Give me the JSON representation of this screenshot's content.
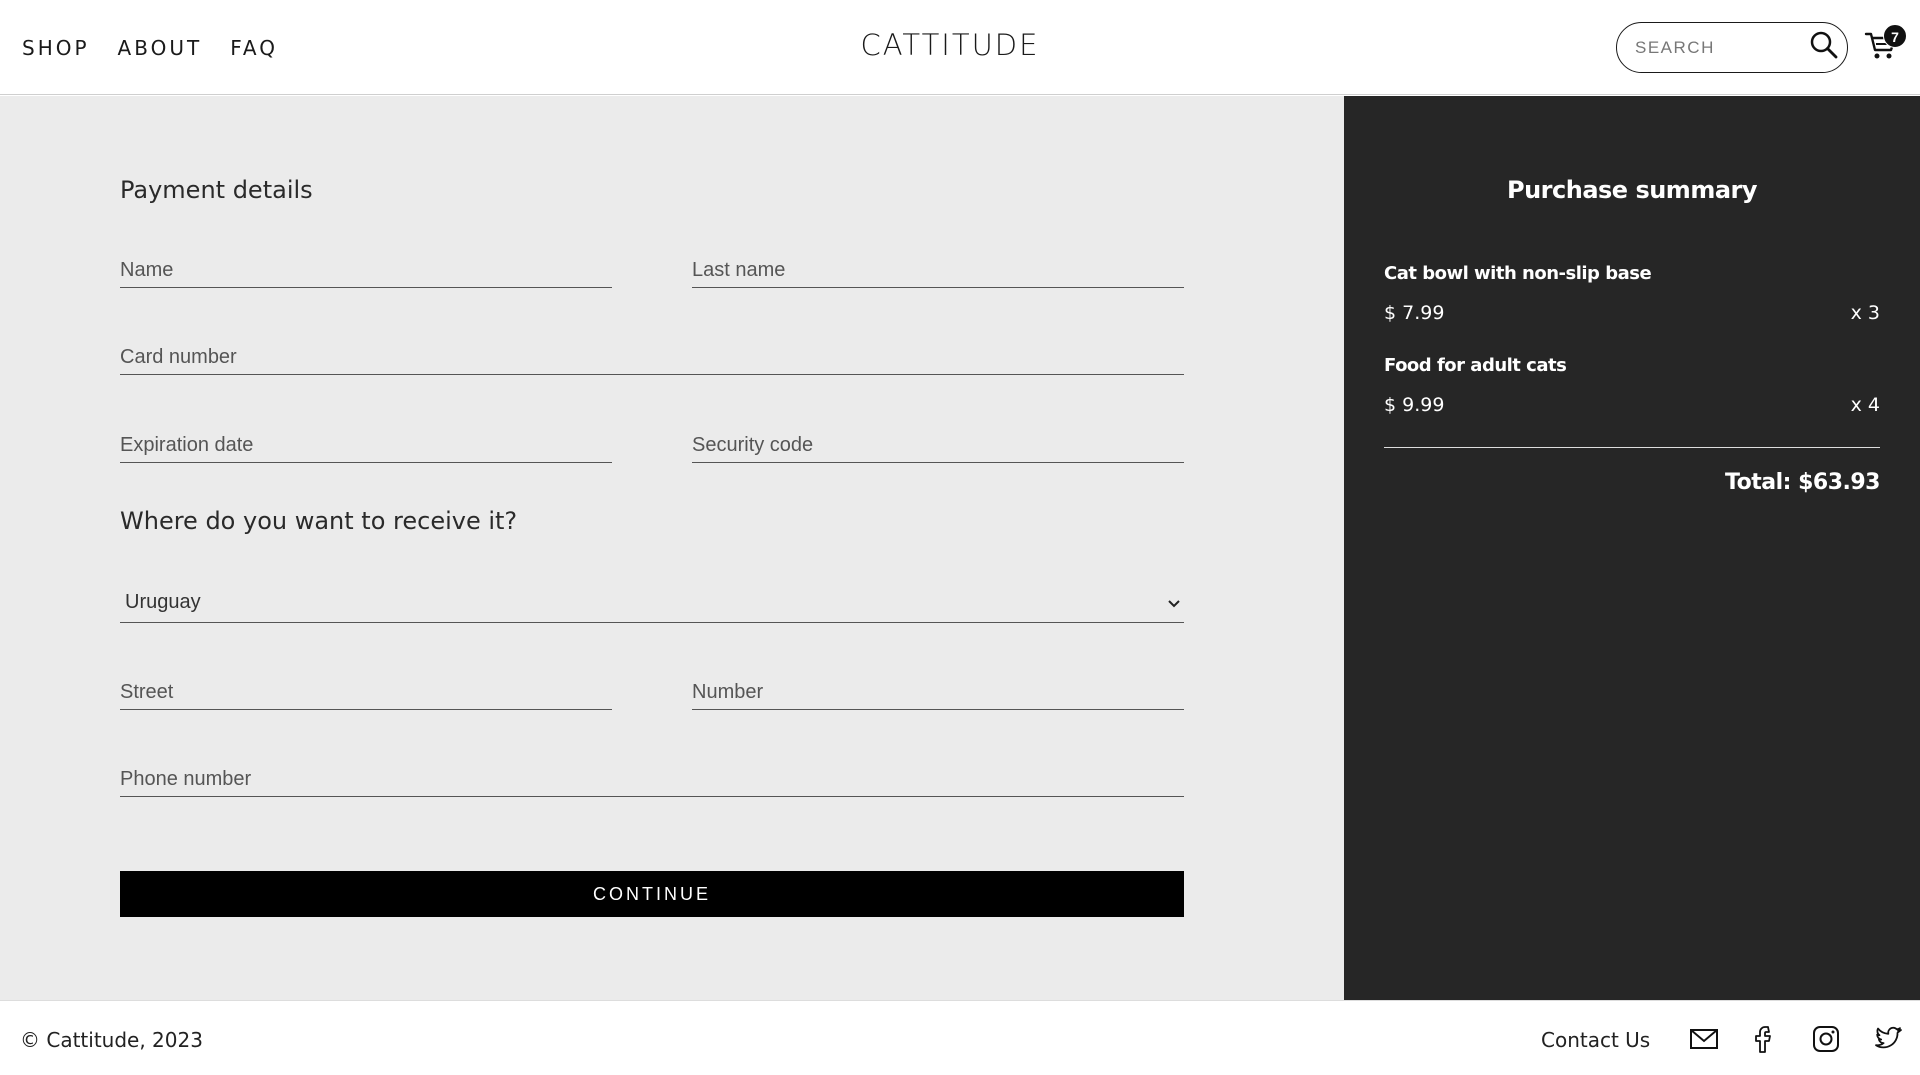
{
  "header": {
    "nav": [
      "SHOP",
      "ABOUT",
      "FAQ"
    ],
    "logo": "CATTITUDE",
    "search_placeholder": "SEARCH",
    "cart_count": "7"
  },
  "form": {
    "payment_title": "Payment details",
    "name_placeholder": "Name",
    "lastname_placeholder": "Last name",
    "card_placeholder": "Card number",
    "expiration_placeholder": "Expiration date",
    "security_placeholder": "Security code",
    "shipping_title": "Where do you want to receive it?",
    "country_value": "Uruguay",
    "street_placeholder": "Street",
    "number_placeholder": "Number",
    "phone_placeholder": "Phone number",
    "continue_label": "CONTINUE"
  },
  "summary": {
    "title": "Purchase summary",
    "items": [
      {
        "name": "Cat bowl with non-slip base",
        "price": "$ 7.99",
        "qty": "x 3"
      },
      {
        "name": "Food for adult cats",
        "price": "$ 9.99",
        "qty": "x 4"
      }
    ],
    "total": "Total: $63.93"
  },
  "footer": {
    "copyright": "© Cattitude, 2023",
    "contact": "Contact Us",
    "icons": [
      "mail-icon",
      "facebook-icon",
      "instagram-icon",
      "twitter-icon"
    ]
  },
  "colors": {
    "form_bg": "#ebebeb",
    "summary_bg": "#262626",
    "button_bg": "#000000"
  }
}
